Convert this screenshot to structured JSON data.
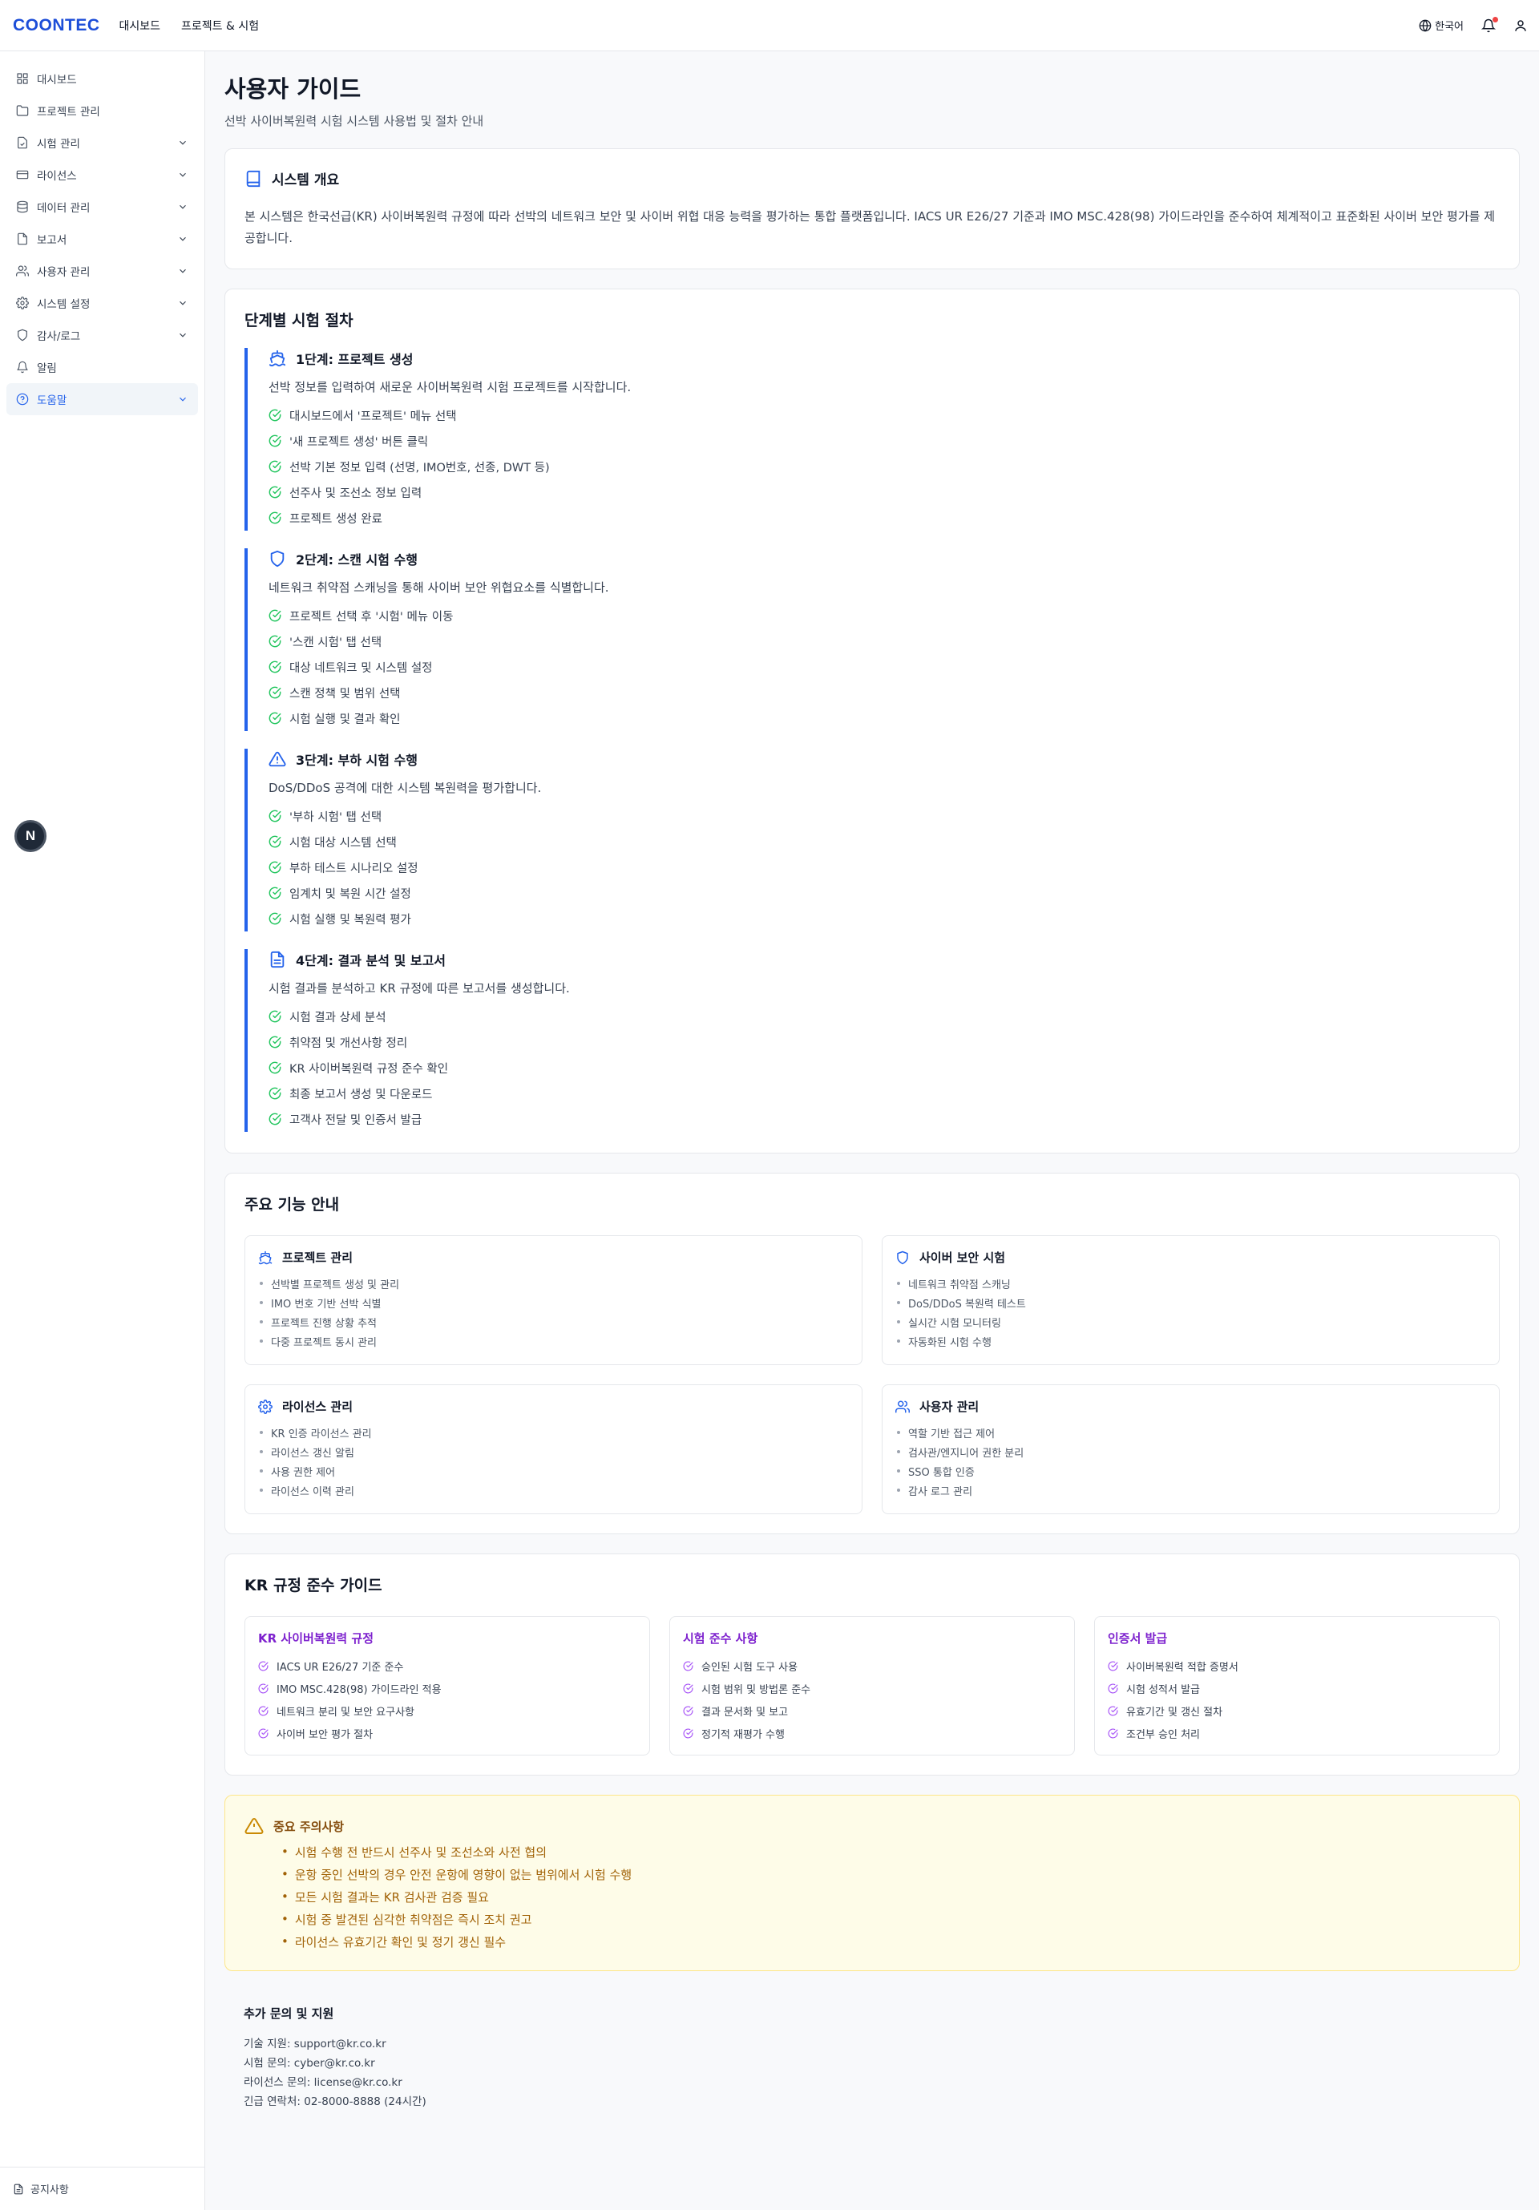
{
  "header": {
    "logo": "COONTEC",
    "nav": [
      "대시보드",
      "프로젝트 & 시험"
    ],
    "language": "한국어"
  },
  "sidebar": {
    "items": [
      {
        "label": "대시보드",
        "icon": "dashboard-icon",
        "expandable": false
      },
      {
        "label": "프로젝트 관리",
        "icon": "folder-icon",
        "expandable": false
      },
      {
        "label": "시험 관리",
        "icon": "test-icon",
        "expandable": true
      },
      {
        "label": "라이선스",
        "icon": "card-icon",
        "expandable": true
      },
      {
        "label": "데이터 관리",
        "icon": "database-icon",
        "expandable": true
      },
      {
        "label": "보고서",
        "icon": "report-icon",
        "expandable": true
      },
      {
        "label": "사용자 관리",
        "icon": "users-icon",
        "expandable": true
      },
      {
        "label": "시스템 설정",
        "icon": "gear-icon",
        "expandable": true
      },
      {
        "label": "감사/로그",
        "icon": "shield-icon",
        "expandable": true
      },
      {
        "label": "알림",
        "icon": "bell-icon",
        "expandable": false
      },
      {
        "label": "도움말",
        "icon": "help-icon",
        "expandable": true,
        "active": true
      }
    ],
    "footer": "공지사항",
    "badge": "N"
  },
  "page": {
    "title": "사용자 가이드",
    "subtitle": "선박 사이버복원력 시험 시스템 사용법 및 절차 안내"
  },
  "overview": {
    "title": "시스템 개요",
    "text": "본 시스템은 한국선급(KR) 사이버복원력 규정에 따라 선박의 네트워크 보안 및 사이버 위협 대응 능력을 평가하는 통합 플랫폼입니다. IACS UR E26/27 기준과 IMO MSC.428(98) 가이드라인을 준수하여 체계적이고 표준화된 사이버 보안 평가를 제공합니다."
  },
  "steps": {
    "title": "단계별 시험 절차",
    "items": [
      {
        "title": "1단계: 프로젝트 생성",
        "desc": "선박 정보를 입력하여 새로운 사이버복원력 시험 프로젝트를 시작합니다.",
        "icon": "ship-icon",
        "checks": [
          "대시보드에서 '프로젝트' 메뉴 선택",
          "'새 프로젝트 생성' 버튼 클릭",
          "선박 기본 정보 입력 (선명, IMO번호, 선종, DWT 등)",
          "선주사 및 조선소 정보 입력",
          "프로젝트 생성 완료"
        ]
      },
      {
        "title": "2단계: 스캔 시험 수행",
        "desc": "네트워크 취약점 스캐닝을 통해 사이버 보안 위협요소를 식별합니다.",
        "icon": "shield-icon",
        "checks": [
          "프로젝트 선택 후 '시험' 메뉴 이동",
          "'스캔 시험' 탭 선택",
          "대상 네트워크 및 시스템 설정",
          "스캔 정책 및 범위 선택",
          "시험 실행 및 결과 확인"
        ]
      },
      {
        "title": "3단계: 부하 시험 수행",
        "desc": "DoS/DDoS 공격에 대한 시스템 복원력을 평가합니다.",
        "icon": "warning-icon",
        "checks": [
          "'부하 시험' 탭 선택",
          "시험 대상 시스템 선택",
          "부하 테스트 시나리오 설정",
          "임계치 및 복원 시간 설정",
          "시험 실행 및 복원력 평가"
        ]
      },
      {
        "title": "4단계: 결과 분석 및 보고서",
        "desc": "시험 결과를 분석하고 KR 규정에 따른 보고서를 생성합니다.",
        "icon": "document-icon",
        "checks": [
          "시험 결과 상세 분석",
          "취약점 및 개선사항 정리",
          "KR 사이버복원력 규정 준수 확인",
          "최종 보고서 생성 및 다운로드",
          "고객사 전달 및 인증서 발급"
        ]
      }
    ]
  },
  "features": {
    "title": "주요 기능 안내",
    "cards": [
      {
        "title": "프로젝트 관리",
        "icon": "ship-icon",
        "items": [
          "선박별 프로젝트 생성 및 관리",
          "IMO 번호 기반 선박 식별",
          "프로젝트 진행 상황 추적",
          "다중 프로젝트 동시 관리"
        ]
      },
      {
        "title": "사이버 보안 시험",
        "icon": "shield-icon",
        "items": [
          "네트워크 취약점 스캐닝",
          "DoS/DDoS 복원력 테스트",
          "실시간 시험 모니터링",
          "자동화된 시험 수행"
        ]
      },
      {
        "title": "라이선스 관리",
        "icon": "gear-icon",
        "items": [
          "KR 인증 라이선스 관리",
          "라이선스 갱신 알림",
          "사용 권한 제어",
          "라이선스 이력 관리"
        ]
      },
      {
        "title": "사용자 관리",
        "icon": "users-icon",
        "items": [
          "역할 기반 접근 제어",
          "검사관/엔지니어 권한 분리",
          "SSO 통합 인증",
          "감사 로그 관리"
        ]
      }
    ]
  },
  "compliance": {
    "title": "KR 규정 준수 가이드",
    "cards": [
      {
        "title": "KR 사이버복원력 규정",
        "items": [
          "IACS UR E26/27 기준 준수",
          "IMO MSC.428(98) 가이드라인 적용",
          "네트워크 분리 및 보안 요구사항",
          "사이버 보안 평가 절차"
        ]
      },
      {
        "title": "시험 준수 사항",
        "items": [
          "승인된 시험 도구 사용",
          "시험 범위 및 방법론 준수",
          "결과 문서화 및 보고",
          "정기적 재평가 수행"
        ]
      },
      {
        "title": "인증서 발급",
        "items": [
          "사이버복원력 적합 증명서",
          "시험 성적서 발급",
          "유효기간 및 갱신 절차",
          "조건부 승인 처리"
        ]
      }
    ]
  },
  "warning": {
    "title": "중요 주의사항",
    "items": [
      "시험 수행 전 반드시 선주사 및 조선소와 사전 협의",
      "운항 중인 선박의 경우 안전 운항에 영향이 없는 범위에서 시험 수행",
      "모든 시험 결과는 KR 검사관 검증 필요",
      "시험 중 발견된 심각한 취약점은 즉시 조치 권고",
      "라이선스 유효기간 확인 및 정기 갱신 필수"
    ]
  },
  "contact": {
    "title": "추가 문의 및 지원",
    "lines": [
      "기술 지원: support@kr.co.kr",
      "시험 문의: cyber@kr.co.kr",
      "라이선스 문의: license@kr.co.kr",
      "긴급 연락처: 02-8000-8888 (24시간)"
    ]
  },
  "colors": {
    "brand": "#1d4ed8",
    "accent": "#2563eb",
    "check": "#22c55e",
    "compliance": "#7e22ce",
    "warning": "#a16207"
  }
}
